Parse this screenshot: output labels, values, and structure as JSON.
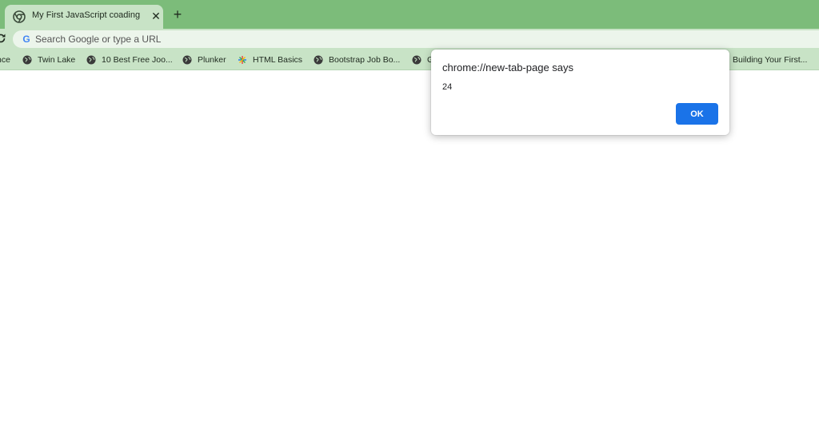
{
  "colors": {
    "frame": "#7cbc7a",
    "toolbar": "#c8e3c6",
    "omnibox": "#ecf5eb",
    "dialog_button": "#1a73e8"
  },
  "tab": {
    "title": "My First JavaScript coading",
    "favicon": "chrome-icon",
    "close_glyph": "✕"
  },
  "new_tab_glyph": "+",
  "omnibox": {
    "placeholder": "Search Google or type a URL",
    "value": ""
  },
  "bookmarks": [
    {
      "label": "nce",
      "icon": "globe-icon"
    },
    {
      "label": "Twin Lake",
      "icon": "globe-icon"
    },
    {
      "label": "10 Best Free Joo...",
      "icon": "globe-icon"
    },
    {
      "label": "Plunker",
      "icon": "globe-icon"
    },
    {
      "label": "HTML Basics",
      "icon": "star-burst-icon"
    },
    {
      "label": "Bootstrap Job Bo...",
      "icon": "globe-icon"
    },
    {
      "label": "G",
      "icon": "globe-icon"
    },
    {
      "label": "Building Your First...",
      "icon": "globe-icon"
    }
  ],
  "dialog": {
    "title": "chrome://new-tab-page says",
    "message": "24",
    "ok_label": "OK"
  }
}
